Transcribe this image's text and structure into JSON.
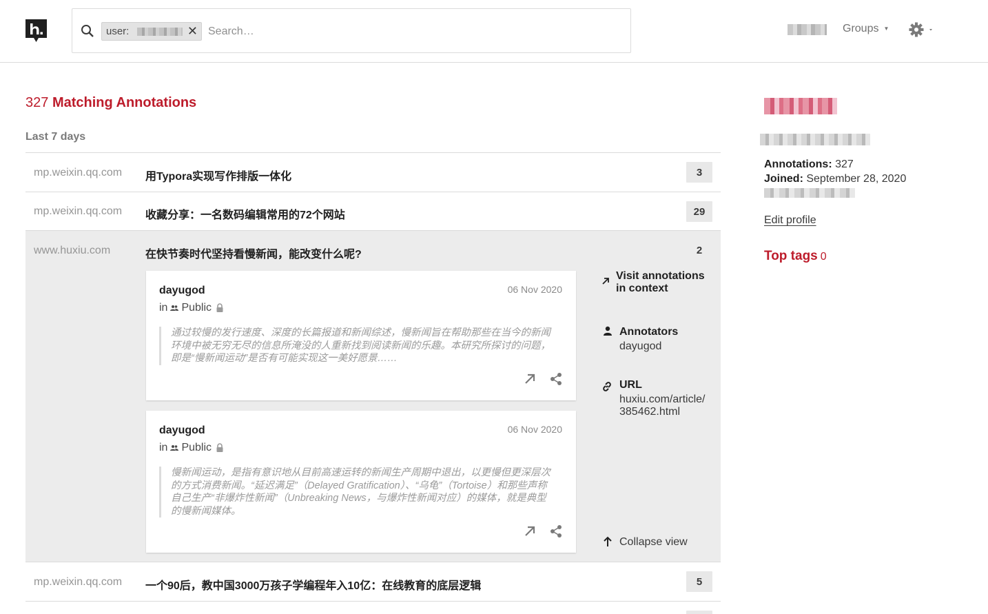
{
  "header": {
    "logo_icon": "hypothesis-logo-icon",
    "search": {
      "icon": "search-icon",
      "lozenge_prefix": "user:",
      "lozenge_close": "✕",
      "placeholder": "Search…"
    },
    "groups_label": "Groups",
    "settings_icon": "gear-icon"
  },
  "results": {
    "title_count": "327",
    "title_text": "Matching Annotations",
    "timeframe": "Last 7 days",
    "rows": [
      {
        "domain": "mp.weixin.qq.com",
        "title": "用Typora实现写作排版一体化",
        "count": "3"
      },
      {
        "domain": "mp.weixin.qq.com",
        "title": "收藏分享：一名数码编辑常用的72个网站",
        "count": "29"
      },
      {
        "domain": "www.huxiu.com",
        "title": "在快节奏时代坚持看慢新闻，能改变什么呢?",
        "count": "2"
      },
      {
        "domain": "mp.weixin.qq.com",
        "title": "一个90后，教中国3000万孩子学编程年入10亿：在线教育的底层逻辑",
        "count": "5"
      }
    ],
    "cards": [
      {
        "author": "dayugod",
        "date": "06 Nov 2020",
        "in_label": "in",
        "group": "Public",
        "quote": "通过较慢的发行速度、深度的长篇报道和新闻综述，慢新闻旨在帮助那些在当今的新闻环境中被无穷无尽的信息所淹没的人重新找到阅读新闻的乐趣。本研究所探讨的问题，即是“慢新闻运动”是否有可能实现这一美好愿景……"
      },
      {
        "author": "dayugod",
        "date": "06 Nov 2020",
        "in_label": "in",
        "group": "Public",
        "quote": "慢新闻运动，是指有意识地从目前高速运转的新闻生产周期中退出，以更慢但更深层次的方式消费新闻。“延迟满足”（Delayed Gratification）、“乌龟”（Tortoise）和那些声称自己生产“非爆炸性新闻”（Unbreaking News，与爆炸性新闻对应）的媒体，就是典型的慢新闻媒体。"
      }
    ],
    "side": {
      "visit_line1": "Visit annotations",
      "visit_line2": "in context",
      "annotators_label": "Annotators",
      "annotators_value": "dayugod",
      "url_label": "URL",
      "url_line1": "huxiu.com/article/",
      "url_line2": "385462.html",
      "collapse_label": "Collapse view"
    }
  },
  "profile": {
    "annotations_label": "Annotations:",
    "annotations_value": "327",
    "joined_label": "Joined:",
    "joined_value": "September 28, 2020",
    "edit_profile": "Edit profile",
    "top_tags_label": "Top tags",
    "top_tags_count": "0"
  }
}
